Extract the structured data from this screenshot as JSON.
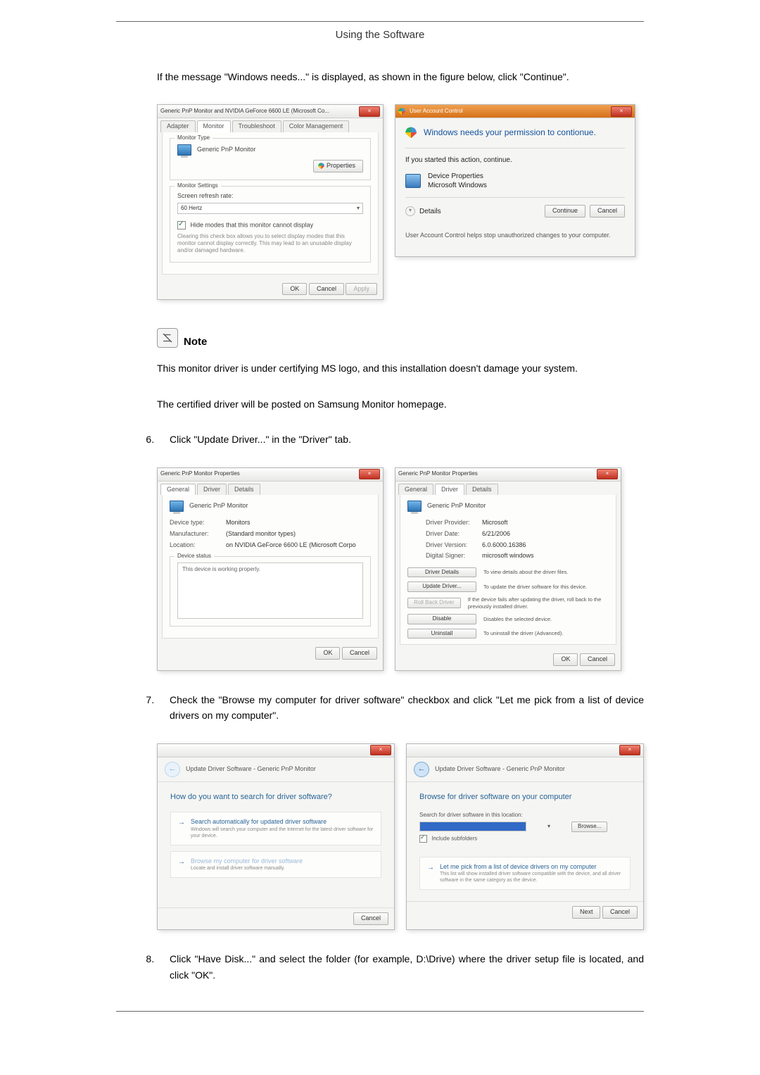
{
  "header": {
    "title": "Using the Software"
  },
  "intro": "If the message \"Windows needs...\" is displayed, as shown in the figure below, click \"Continue\".",
  "fig1_left": {
    "title": "Generic PnP Monitor and NVIDIA GeForce 6600 LE (Microsoft Co...",
    "tabs": [
      "Adapter",
      "Monitor",
      "Troubleshoot",
      "Color Management"
    ],
    "monitor_type_label": "Monitor Type",
    "monitor_name": "Generic PnP Monitor",
    "properties_btn": "Properties",
    "monitor_settings_label": "Monitor Settings",
    "refresh_label": "Screen refresh rate:",
    "refresh_value": "60 Hertz",
    "hide_modes": "Hide modes that this monitor cannot display",
    "hide_desc": "Clearing this check box allows you to select display modes that this monitor cannot display correctly. This may lead to an unusable display and/or damaged hardware.",
    "ok": "OK",
    "cancel": "Cancel",
    "apply": "Apply"
  },
  "fig1_right": {
    "title": "User Account Control",
    "banner": "Windows needs your permission to contionue.",
    "started": "If you started this action, continue.",
    "prog": "Device Properties",
    "pub": "Microsoft Windows",
    "details": "Details",
    "continue": "Continue",
    "cancel": "Cancel",
    "foot": "User Account Control helps stop unauthorized changes to your computer."
  },
  "note": {
    "label": "Note",
    "p1": "This monitor driver is under certifying MS logo, and this installation doesn't damage your system.",
    "p2": "The certified driver will be posted on Samsung Monitor homepage."
  },
  "steps": {
    "s6": "Click \"Update Driver...\" in the \"Driver\" tab.",
    "s7": "Check the \"Browse my computer for driver software\" checkbox and click \"Let me pick from a list of device drivers on my computer\".",
    "s8": "Click \"Have Disk...\" and select the folder (for example, D:\\Drive) where the driver setup file is located, and click \"OK\"."
  },
  "fig2_left": {
    "title": "Generic PnP Monitor Properties",
    "tabs": [
      "General",
      "Driver",
      "Details"
    ],
    "name": "Generic PnP Monitor",
    "kv": {
      "type_l": "Device type:",
      "type_v": "Monitors",
      "mfg_l": "Manufacturer:",
      "mfg_v": "(Standard monitor types)",
      "loc_l": "Location:",
      "loc_v": "on NVIDIA GeForce 6600 LE (Microsoft Corpo"
    },
    "status_label": "Device status",
    "status_text": "This device is working properly.",
    "ok": "OK",
    "cancel": "Cancel"
  },
  "fig2_right": {
    "title": "Generic PnP Monitor Properties",
    "tabs": [
      "General",
      "Driver",
      "Details"
    ],
    "name": "Generic PnP Monitor",
    "kv": {
      "prov_l": "Driver Provider:",
      "prov_v": "Microsoft",
      "date_l": "Driver Date:",
      "date_v": "6/21/2006",
      "ver_l": "Driver Version:",
      "ver_v": "6.0.6000.16386",
      "sig_l": "Digital Signer:",
      "sig_v": "microsoft windows"
    },
    "btns": {
      "details": "Driver Details",
      "details_d": "To view details about the driver files.",
      "update": "Update Driver...",
      "update_d": "To update the driver software for this device.",
      "rollback": "Roll Back Driver",
      "rollback_d": "If the device fails after updating the driver, roll back to the previously installed driver.",
      "disable": "Disable",
      "disable_d": "Disables the selected device.",
      "uninstall": "Uninstall",
      "uninstall_d": "To uninstall the driver (Advanced)."
    },
    "ok": "OK",
    "cancel": "Cancel"
  },
  "fig3_left": {
    "title": "Update Driver Software - Generic PnP Monitor",
    "heading": "How do you want to search for driver software?",
    "opt1_t": "Search automatically for updated driver software",
    "opt1_d": "Windows will search your computer and the Internet for the latest driver software for your device.",
    "opt2_t": "Browse my computer for driver software",
    "opt2_d": "Locate and install driver software manually.",
    "cancel": "Cancel"
  },
  "fig3_right": {
    "title": "Update Driver Software - Generic PnP Monitor",
    "heading": "Browse for driver software on your computer",
    "search_l": "Search for driver software in this location:",
    "browse": "Browse...",
    "include": "Include subfolders",
    "opt_t": "Let me pick from a list of device drivers on my computer",
    "opt_d": "This list will show installed driver software compatible with the device, and all driver software in the same category as the device.",
    "next": "Next",
    "cancel": "Cancel"
  }
}
